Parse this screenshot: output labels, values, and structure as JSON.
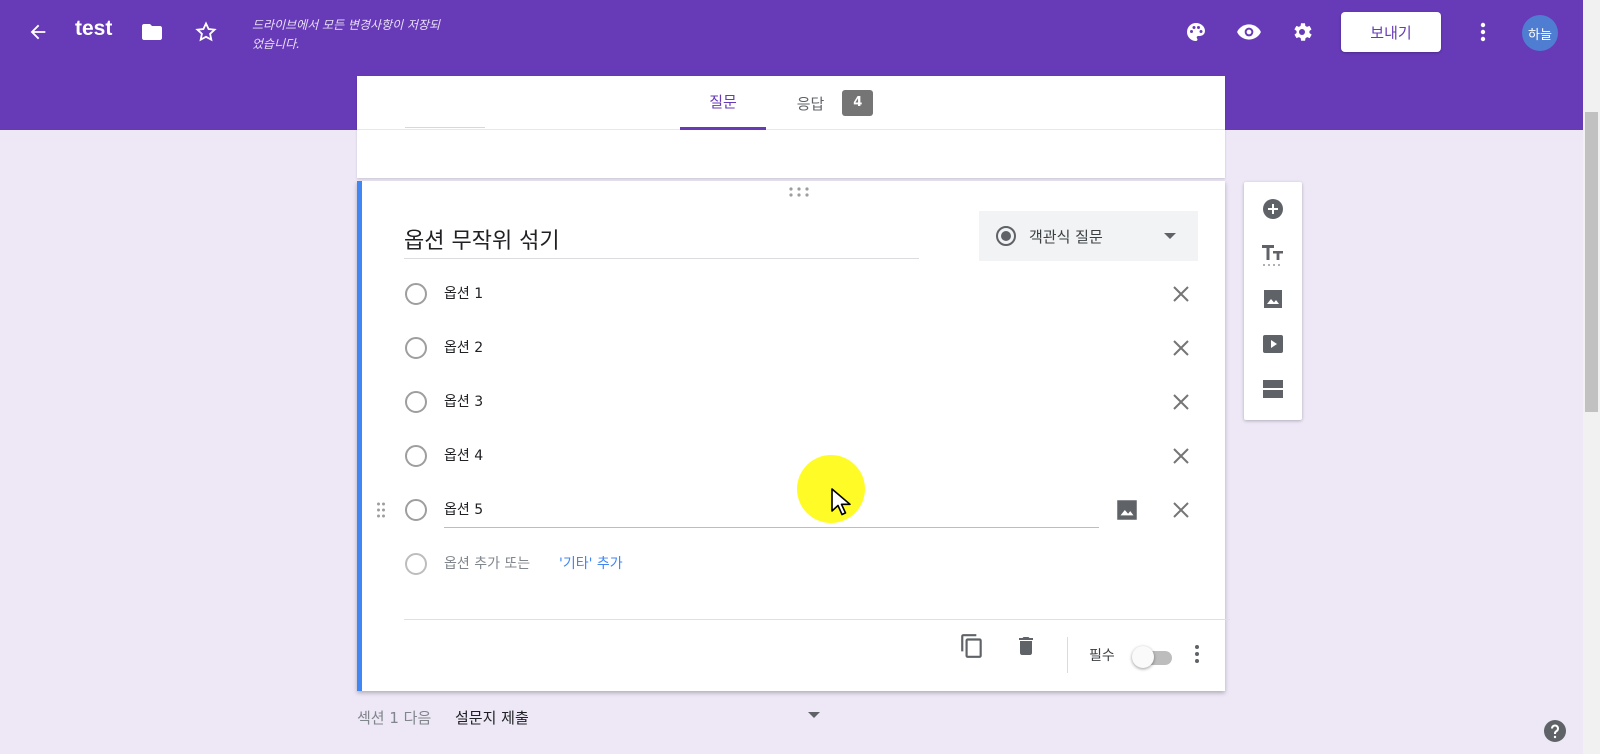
{
  "header": {
    "title": "test",
    "save_status": "드라이브에서 모든 변경사항이 저장되었습니다.",
    "send_label": "보내기",
    "avatar_initials": "하늘",
    "bar_color": "#673ab7",
    "icons": [
      "arrow-back-icon",
      "folder-icon",
      "star-icon",
      "palette-icon",
      "eye-icon",
      "gear-icon",
      "more-vert-icon"
    ]
  },
  "tabs": {
    "questions": "질문",
    "responses": "응답",
    "responses_count": "4"
  },
  "question": {
    "title": "옵션 무작위 섞기",
    "type_label": "객관식 질문",
    "options": [
      {
        "label": "옵션 1"
      },
      {
        "label": "옵션 2"
      },
      {
        "label": "옵션 3"
      },
      {
        "label": "옵션 4"
      },
      {
        "label": "옵션 5"
      }
    ],
    "add_option_label": "옵션 추가 또는",
    "add_other_label": "'기타' 추가",
    "required_label": "필수",
    "required_on": false,
    "accent_color": "#4285f4"
  },
  "side_toolbar": [
    "add-question-icon",
    "title-text-icon",
    "image-icon",
    "video-icon",
    "section-icon"
  ],
  "section_nav": {
    "prefix": "섹션 1 다음",
    "target": "설문지 제출"
  }
}
